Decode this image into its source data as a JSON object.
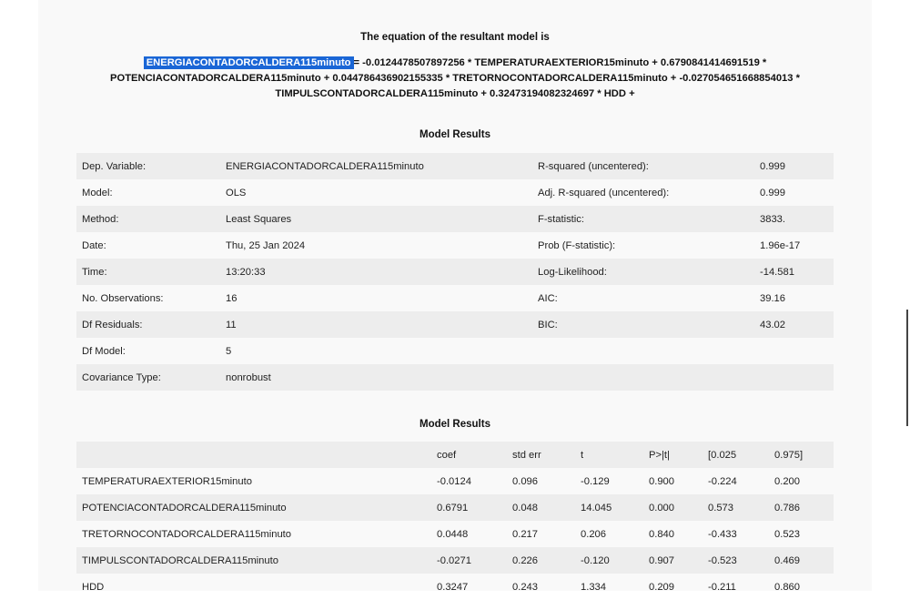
{
  "equation": {
    "heading": "The equation of the resultant model is",
    "dependent": "ENERGIACONTADORCALDERA115minuto",
    "rhs": "= -0.0124478507897256 * TEMPERATURAEXTERIOR15minuto + 0.6790841414691519 * POTENCIACONTADORCALDERA115minuto + 0.044786436902155335 * TRETORNOCONTADORCALDERA115minuto + -0.027054651668854013 * TIMPULSCONTADORCALDERA115minuto + 0.32473194082324697 * HDD +"
  },
  "summary": {
    "heading": "Model Results",
    "rows": [
      [
        "Dep. Variable:",
        "ENERGIACONTADORCALDERA115minuto",
        "R-squared (uncentered):",
        "0.999"
      ],
      [
        "Model:",
        "OLS",
        "Adj. R-squared (uncentered):",
        "0.999"
      ],
      [
        "Method:",
        "Least Squares",
        "F-statistic:",
        "3833."
      ],
      [
        "Date:",
        "Thu, 25 Jan 2024",
        "Prob (F-statistic):",
        "1.96e-17"
      ],
      [
        "Time:",
        "13:20:33",
        "Log-Likelihood:",
        "-14.581"
      ],
      [
        "No. Observations:",
        "16",
        "AIC:",
        "39.16"
      ],
      [
        "Df Residuals:",
        "11",
        "BIC:",
        "43.02"
      ],
      [
        "Df Model:",
        "5",
        "",
        ""
      ],
      [
        "Covariance Type:",
        "nonrobust",
        "",
        ""
      ]
    ]
  },
  "coefs": {
    "heading": "Model Results",
    "headers": [
      "",
      "coef",
      "std err",
      "t",
      "P>|t|",
      "[0.025",
      "0.975]"
    ],
    "rows": [
      [
        "TEMPERATURAEXTERIOR15minuto",
        "-0.0124",
        "0.096",
        "-0.129",
        "0.900",
        "-0.224",
        "0.200"
      ],
      [
        "POTENCIACONTADORCALDERA115minuto",
        "0.6791",
        "0.048",
        "14.045",
        "0.000",
        "0.573",
        "0.786"
      ],
      [
        "TRETORNOCONTADORCALDERA115minuto",
        "0.0448",
        "0.217",
        "0.206",
        "0.840",
        "-0.433",
        "0.523"
      ],
      [
        "TIMPULSCONTADORCALDERA115minuto",
        "-0.0271",
        "0.226",
        "-0.120",
        "0.907",
        "-0.523",
        "0.469"
      ],
      [
        "HDD",
        "0.3247",
        "0.243",
        "1.334",
        "0.209",
        "-0.211",
        "0.860"
      ]
    ]
  }
}
